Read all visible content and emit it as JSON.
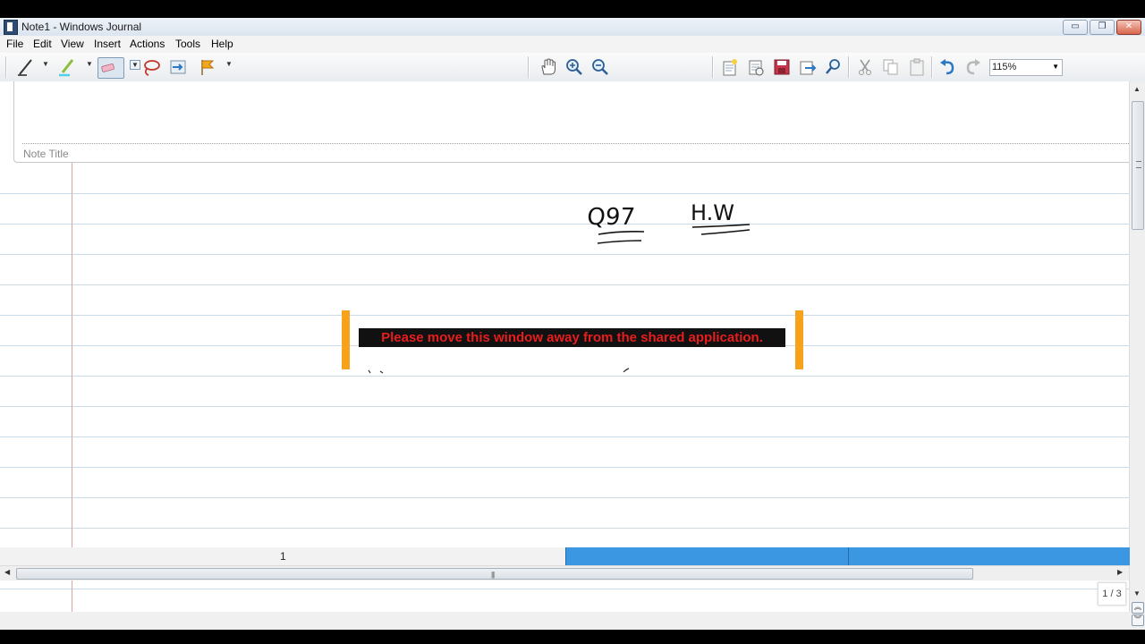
{
  "window": {
    "title": "Note1 - Windows Journal"
  },
  "window_controls": {
    "minimize": "▭",
    "restore": "❐",
    "close": "✕"
  },
  "menu": [
    {
      "label": "File"
    },
    {
      "label": "Edit"
    },
    {
      "label": "View"
    },
    {
      "label": "Insert"
    },
    {
      "label": "Actions"
    },
    {
      "label": "Tools"
    },
    {
      "label": "Help"
    }
  ],
  "toolbar": {
    "zoom_value": "115%",
    "icons": [
      "pen-icon",
      "highlighter-icon",
      "eraser-icon",
      "lasso-icon",
      "insert-space-icon",
      "flag-icon",
      "pan-icon",
      "zoom-in-icon",
      "zoom-out-icon",
      "new-note-icon",
      "open-icon",
      "save-icon",
      "send-icon",
      "find-icon",
      "cut-icon",
      "copy-icon",
      "paste-icon",
      "undo-icon",
      "redo-icon"
    ]
  },
  "note": {
    "title_placeholder": "Note Title",
    "ink_text": [
      "Q97",
      "H.W"
    ]
  },
  "share_notice": {
    "message": "Please move this window away from the shared application.",
    "bar_color": "#f6a21b",
    "text_color": "#e81d1d"
  },
  "status": {
    "page_counter": "1 / 3",
    "page_number": "1"
  },
  "colors": {
    "rule_line": "#c9dbe9",
    "margin_line": "#d9a6a6",
    "page_strip_blue": "#3c97e3"
  }
}
